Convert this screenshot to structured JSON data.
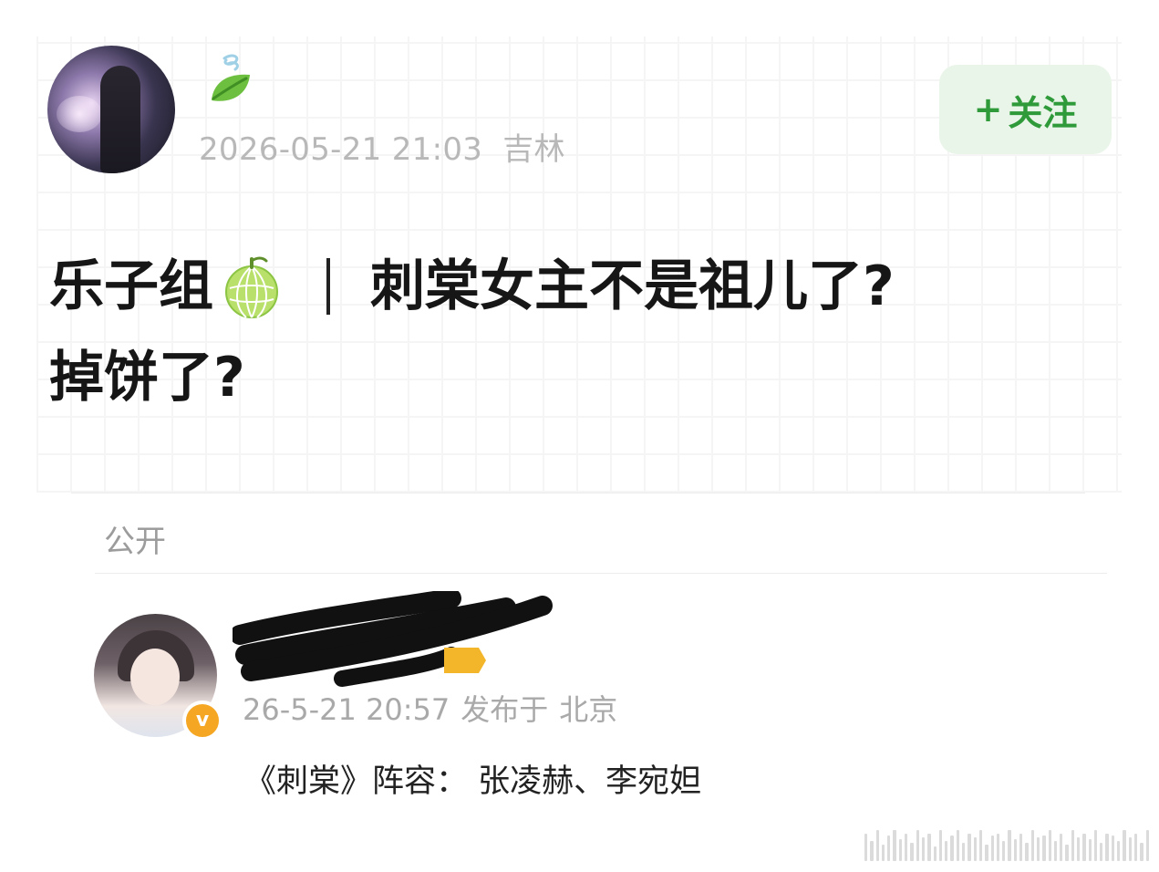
{
  "post": {
    "timestamp": "2026-05-21 21:03",
    "location": "吉林",
    "follow_button": {
      "plus": "+",
      "label": "关注"
    },
    "title": {
      "prefix": "乐子组",
      "main": "刺棠女主不是祖儿了?",
      "second_line": "掉饼了?"
    },
    "visibility": "公开"
  },
  "quoted": {
    "timestamp": "26-5-21 20:57",
    "published_at_label": "发布于",
    "location": "北京",
    "text": "《刺棠》阵容： 张凌赫、李宛妲",
    "badge_glyph": "v"
  },
  "colors": {
    "accent_green": "#2f9a3a",
    "follow_bg": "#eaf5e9",
    "verified_orange": "#f5a623",
    "meta_gray": "#b8b8b8"
  },
  "icons": {
    "post_badge": "leaf-icon",
    "title_emoji": "melon-icon",
    "verified": "verified-badge"
  }
}
